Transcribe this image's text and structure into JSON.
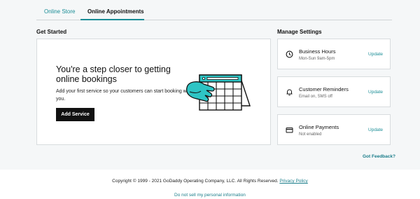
{
  "tabs": [
    {
      "label": "Online Store",
      "active": false
    },
    {
      "label": "Online Appointments",
      "active": true
    }
  ],
  "get_started": {
    "heading": "Get Started",
    "title": "You're a step closer to getting online bookings",
    "description": "Add your first service so your customers can start booking with you.",
    "button_label": "Add Service"
  },
  "manage": {
    "heading": "Manage Settings",
    "items": [
      {
        "title": "Business Hours",
        "subtitle": "Mon-Sun 9am-5pm",
        "link": "Update",
        "icon": "clock-icon"
      },
      {
        "title": "Customer Reminders",
        "subtitle": "Email on, SMS off",
        "link": "Update",
        "icon": "bell-icon"
      },
      {
        "title": "Online Payments",
        "subtitle": "Not enabled",
        "link": "Update",
        "icon": "credit-card-icon"
      }
    ]
  },
  "feedback_link": "Got Feedback?",
  "footer": {
    "copyright": "Copyright © 1999 - 2021 GoDaddy Operating Company, LLC. All Rights Reserved.",
    "privacy_link": "Privacy Policy",
    "do_not_sell": "Do not sell my personal information"
  },
  "colors": {
    "accent": "#1a8d96",
    "illustration_teal": "#2ec4c4",
    "button": "#111111"
  }
}
